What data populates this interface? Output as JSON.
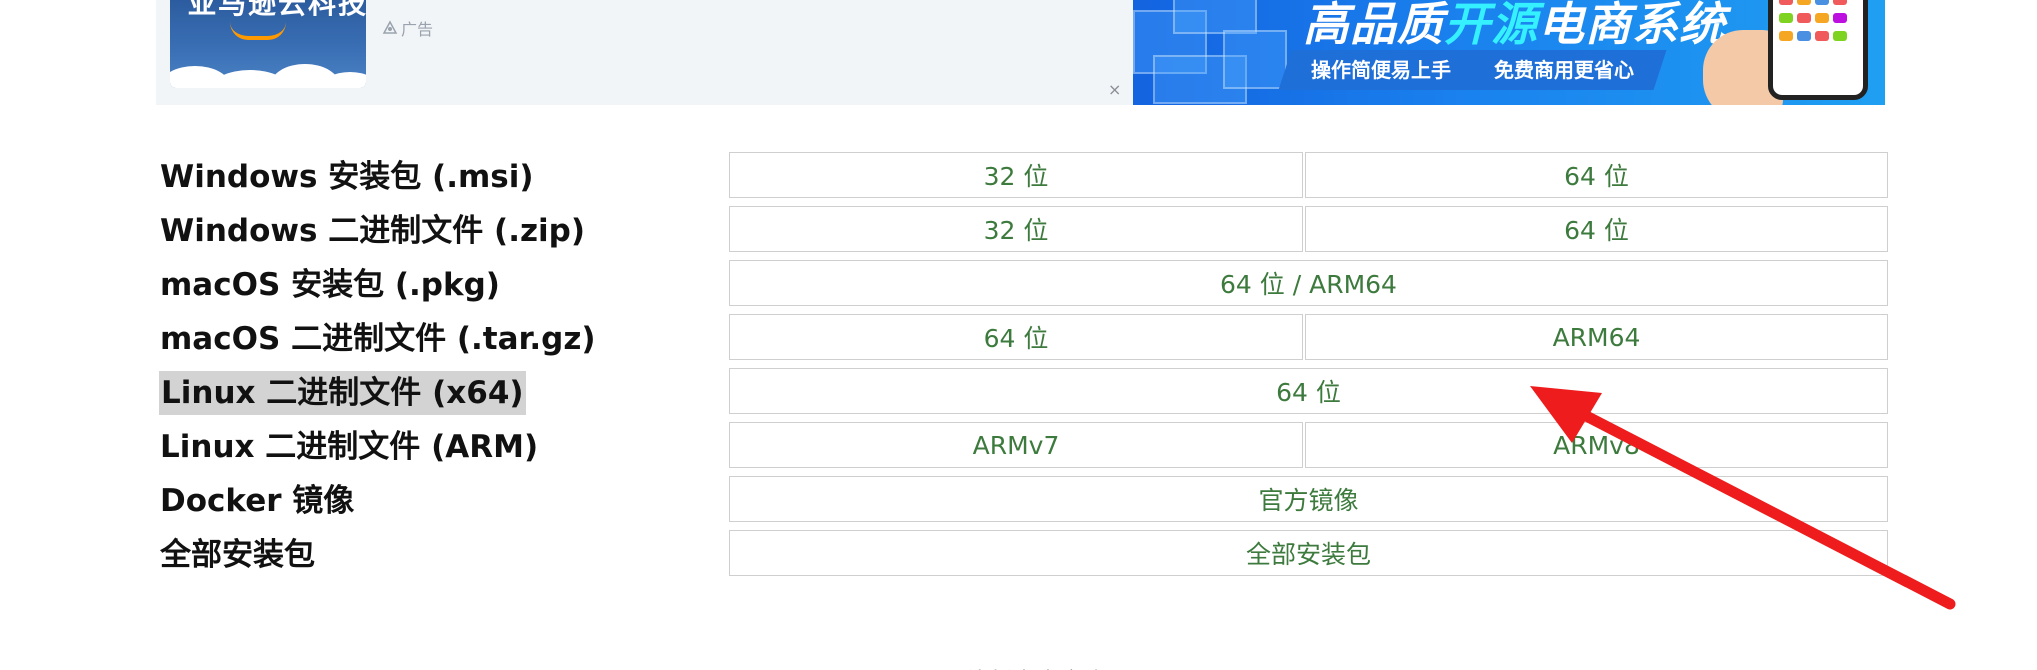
{
  "ads": {
    "left": {
      "thumb_text": "亚马逊云科技",
      "label": "广告",
      "close_symbol": "×"
    },
    "right": {
      "title_part1": "高品质",
      "title_part2": "开源",
      "title_part3": "电商系统",
      "pill1": "操作简便易上手",
      "pill2": "免费商用更省心"
    }
  },
  "downloads": {
    "rows": [
      {
        "label": "Windows 安装包 (.msi)",
        "options": [
          "32 位",
          "64 位"
        ]
      },
      {
        "label": "Windows 二进制文件 (.zip)",
        "options": [
          "32 位",
          "64 位"
        ]
      },
      {
        "label": "macOS 安装包 (.pkg)",
        "options": [
          "64 位 / ARM64"
        ]
      },
      {
        "label": "macOS 二进制文件 (.tar.gz)",
        "options": [
          "64 位",
          "ARM64"
        ]
      },
      {
        "label": "Linux 二进制文件 (x64)",
        "options": [
          "64 位"
        ]
      },
      {
        "label": "Linux 二进制文件 (ARM)",
        "options": [
          "ARMv7",
          "ARMv8"
        ]
      },
      {
        "label": "Docker 镜像",
        "options": [
          "官方镜像"
        ]
      },
      {
        "label": "全部安装包",
        "options": [
          "全部安装包"
        ]
      }
    ]
  },
  "footer_partial": "其他版本未完全",
  "colors": {
    "link_green": "#3d7a3d",
    "annotation_arrow": "#ee1c1c",
    "highlight_bg": "#d3d3d3"
  }
}
